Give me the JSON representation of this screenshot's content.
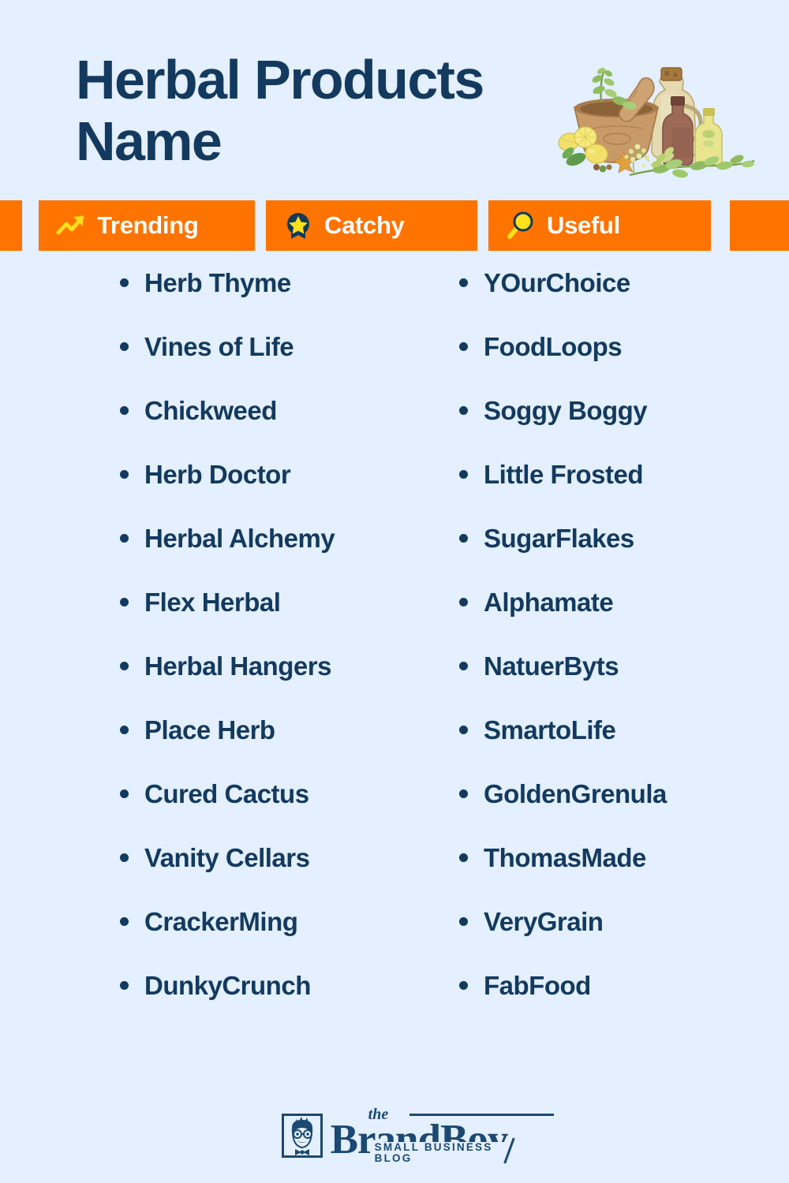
{
  "background_color": "#e4efff",
  "accent_color": "#ff7300",
  "text_color": "#133a5e",
  "icon_yellow": "#ffe01b",
  "header": {
    "title": "Herbal Products Name",
    "illustration_name": "mortar-pestle-herbal-bottles-illustration"
  },
  "badges": [
    {
      "label": "Trending",
      "icon": "trending-up-icon"
    },
    {
      "label": "Catchy",
      "icon": "award-star-icon"
    },
    {
      "label": "Useful",
      "icon": "magnifier-icon"
    }
  ],
  "names": {
    "left_column": [
      "Herb Thyme",
      "Vines of Life",
      "Chickweed",
      "Herb Doctor",
      "Herbal Alchemy",
      "Flex Herbal",
      "Herbal Hangers",
      "Place Herb",
      "Cured Cactus",
      "Vanity Cellars",
      "CrackerMing",
      "DunkyCrunch"
    ],
    "right_column": [
      "YOurChoice",
      "FoodLoops",
      "Soggy Boggy",
      "Little Frosted",
      "SugarFlakes",
      "Alphamate",
      "NatuerByts",
      "SmartoLife",
      "GoldenGrenula",
      "ThomasMade",
      "VeryGrain",
      "FabFood"
    ]
  },
  "footer": {
    "brand_the": "the",
    "brand_name": "BrandBoy",
    "tagline": "SMALL BUSINESS BLOG",
    "avatar_name": "brandboy-mascot-icon"
  }
}
